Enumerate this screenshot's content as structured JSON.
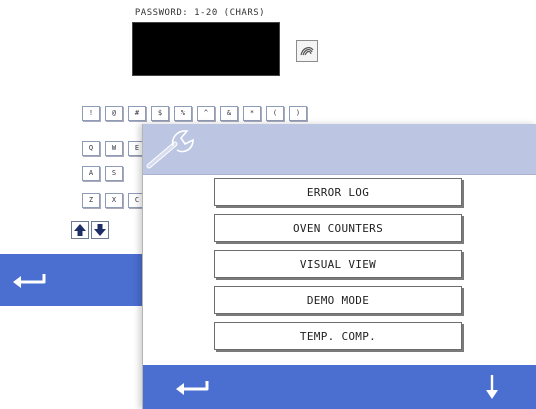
{
  "password_screen": {
    "label": "PASSWORD: 1-20 (CHARS)",
    "password_value": "",
    "keyboard": {
      "row1": [
        "!",
        "@",
        "#",
        "$",
        "%",
        "^",
        "&",
        "*",
        "(",
        ")"
      ],
      "row2": [
        "Q",
        "W",
        "E"
      ],
      "row3": [
        "A",
        "S"
      ],
      "row4": [
        "Z",
        "X",
        "C"
      ]
    },
    "icons": {
      "enter": "enter-icon",
      "shift_up": "arrow-up-icon",
      "shift_down": "arrow-down-icon",
      "back": "back-arrow-icon"
    }
  },
  "menu_screen": {
    "header_icon": "wrench-icon",
    "items": [
      {
        "label": "ERROR LOG"
      },
      {
        "label": "OVEN COUNTERS"
      },
      {
        "label": "VISUAL VIEW"
      },
      {
        "label": "DEMO MODE"
      },
      {
        "label": "TEMP. COMP."
      }
    ],
    "footer_icons": {
      "back": "back-arrow-icon",
      "scroll_down": "arrow-down-icon"
    }
  },
  "colors": {
    "bar_blue": "#4b6ed1",
    "header_lavender": "#bcc6e3",
    "field_black": "#000000"
  }
}
